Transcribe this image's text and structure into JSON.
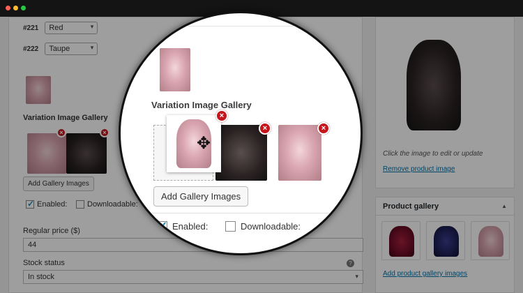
{
  "variations": [
    {
      "id": "#221",
      "value": "Red"
    },
    {
      "id": "#222",
      "value": "Taupe"
    }
  ],
  "gallery": {
    "title": "Variation Image Gallery",
    "add_button": "Add Gallery Images"
  },
  "options": {
    "enabled_label": "Enabled:",
    "enabled_checked": true,
    "downloadable_label": "Downloadable:",
    "downloadable_checked": false
  },
  "price": {
    "label": "Regular price ($)",
    "value": "44"
  },
  "stock": {
    "label": "Stock status",
    "value": "In stock",
    "help": "?"
  },
  "product_image": {
    "caption": "Click the image to edit or update",
    "remove_link": "Remove product image"
  },
  "product_gallery": {
    "title": "Product gallery",
    "add_link": "Add product gallery images"
  },
  "icons": {
    "remove": "×",
    "caret": "▾",
    "move": "✥",
    "collapse": "▲"
  },
  "colors": {
    "remove_badge": "#c4161c",
    "link": "#0073aa",
    "checkbox_check": "#1e8cbe"
  }
}
